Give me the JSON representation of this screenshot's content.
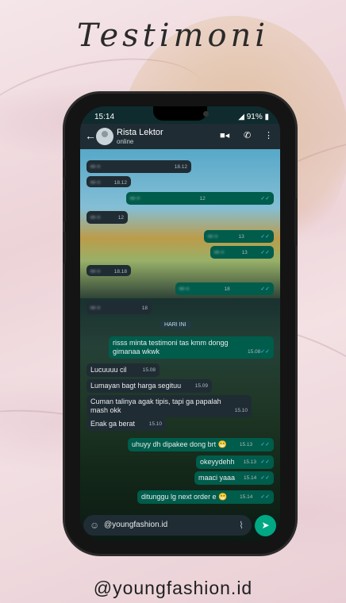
{
  "title": "Testimoni",
  "footer": "@youngfashion.id",
  "status": {
    "time": "15:14",
    "battery": "91%"
  },
  "contact": {
    "name": "Rista Lektor",
    "presence": "online"
  },
  "day_divider": "HARI INI",
  "blurred_messages": [
    {
      "dir": "in",
      "time": "18.12"
    },
    {
      "dir": "in",
      "time": "18.12"
    },
    {
      "dir": "out",
      "time": "12"
    },
    {
      "dir": "in",
      "time": "12"
    },
    {
      "dir": "out",
      "time": "13"
    },
    {
      "dir": "out",
      "time": "13"
    },
    {
      "dir": "in",
      "time": "18.18"
    },
    {
      "dir": "out",
      "time": "18"
    },
    {
      "dir": "in",
      "time": "18"
    }
  ],
  "messages": [
    {
      "dir": "out",
      "text": "risss minta testimoni tas kmm dongg gimanaa wkwk",
      "time": "15.08"
    },
    {
      "dir": "in",
      "text": "Lucuuuu cil",
      "time": "15.08"
    },
    {
      "dir": "in",
      "text": "Lumayan bagt harga segituu",
      "time": "15.09"
    },
    {
      "dir": "in",
      "text": "Cuman talinya agak tipis, tapi ga papalah mash okk",
      "time": "15.10"
    },
    {
      "dir": "in",
      "text": "Enak ga berat",
      "time": "15.10"
    },
    {
      "dir": "out",
      "text": "uhuyy dh dipakee dong brt 😁",
      "time": "15.13"
    },
    {
      "dir": "out",
      "text": "okeyydehh",
      "time": "15.13"
    },
    {
      "dir": "out",
      "text": "maaci yaaa",
      "time": "15.14"
    },
    {
      "dir": "out",
      "text": "ditunggu lg next order e 😁",
      "time": "15.14"
    }
  ],
  "input": {
    "value": "@youngfashion.id"
  },
  "icons": {
    "back": "back-arrow-icon",
    "video": "video-call-icon",
    "call": "phone-call-icon",
    "menu": "more-vert-icon",
    "emoji": "emoji-icon",
    "attach": "paperclip-icon",
    "send": "send-icon"
  },
  "colors": {
    "incoming": "#202c33",
    "outgoing": "#005c4b",
    "send": "#00a884",
    "tick": "#53bdeb"
  }
}
